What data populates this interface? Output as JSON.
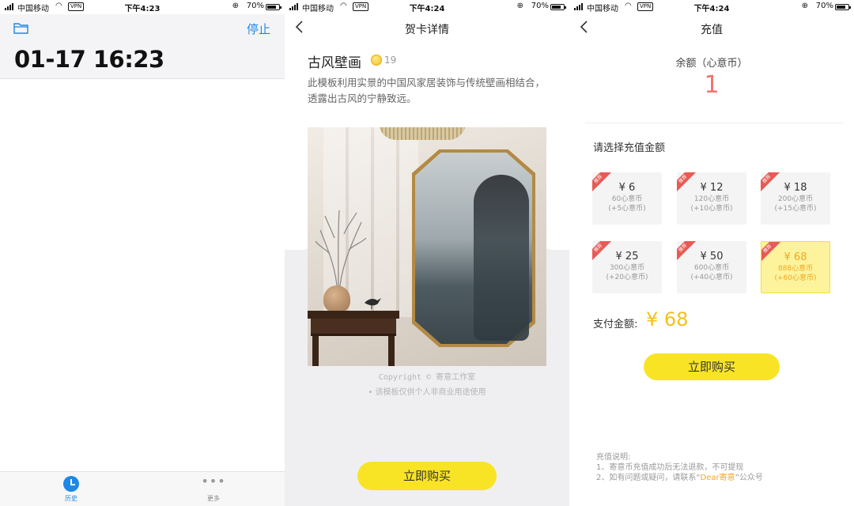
{
  "status_bars": [
    {
      "carrier": "中国移动",
      "vpn": "VPN",
      "time": "下午4:23",
      "battery": "70%"
    },
    {
      "carrier": "中国移动",
      "vpn": "VPN",
      "time": "下午4:24",
      "battery": "70%"
    },
    {
      "carrier": "中国移动",
      "vpn": "VPN",
      "time": "下午4:24",
      "battery": "70%"
    }
  ],
  "screen1": {
    "stop_label": "停止",
    "timestamp": "01-17 16:23",
    "tabs": {
      "history": "历史",
      "more": "更多"
    },
    "folder_icon": "folder-icon"
  },
  "screen2": {
    "nav_title": "贺卡详情",
    "card_title": "古风壁画",
    "coin_count": "19",
    "description": "此模板利用实景的中国风家居装饰与传统壁画相结合，透露出古风的宁静致远。",
    "copyright": "Copyright © 寄意工作室",
    "notice": "• 该模板仅供个人非商业用途使用",
    "buy_label": "立即购买"
  },
  "screen3": {
    "nav_title": "充值",
    "balance_label": "余额（心意币）",
    "balance_value": "1",
    "choose_label": "请选择充值金额",
    "packages": [
      {
        "price": "¥ 6",
        "coins": "60心意币",
        "bonus": "(+5心意币)",
        "ribbon": "推荐"
      },
      {
        "price": "¥ 12",
        "coins": "120心意币",
        "bonus": "(+10心意币)",
        "ribbon": "推荐"
      },
      {
        "price": "¥ 18",
        "coins": "200心意币",
        "bonus": "(+15心意币)",
        "ribbon": "推荐"
      },
      {
        "price": "¥ 25",
        "coins": "300心意币",
        "bonus": "(+20心意币)",
        "ribbon": "推荐"
      },
      {
        "price": "¥ 50",
        "coins": "600心意币",
        "bonus": "(+40心意币)",
        "ribbon": "推荐"
      },
      {
        "price": "¥ 68",
        "coins": "888心意币",
        "bonus": "(+60心意币)",
        "ribbon": "推荐"
      }
    ],
    "selected_index": 5,
    "pay_label": "支付金额:",
    "pay_value": "¥ 68",
    "buy_label": "立即购买",
    "notes_title": "充值说明:",
    "note1": "1、寄意币充值成功后无法退款，不可提现",
    "note2_prefix": "2、如有问题或疑问，请联系“",
    "note2_highlight": "Dear寄意",
    "note2_suffix": "”公众号"
  },
  "colors": {
    "accent_blue": "#1e88e5",
    "button_yellow": "#f8e424",
    "balance_red": "#f07470",
    "price_gold": "#f3c11a"
  }
}
